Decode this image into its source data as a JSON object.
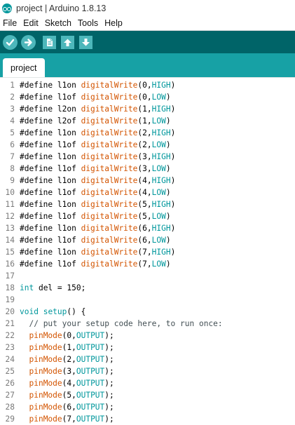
{
  "window": {
    "title": "project | Arduino 1.8.13",
    "icon": "arduino-logo-icon"
  },
  "menu": [
    "File",
    "Edit",
    "Sketch",
    "Tools",
    "Help"
  ],
  "toolbar": {
    "buttons": [
      {
        "name": "verify-button",
        "icon": "check-icon"
      },
      {
        "name": "upload-button",
        "icon": "arrow-right-icon"
      },
      {
        "name": "new-button",
        "icon": "document-icon"
      },
      {
        "name": "open-button",
        "icon": "arrow-up-icon"
      },
      {
        "name": "save-button",
        "icon": "arrow-down-icon"
      }
    ]
  },
  "tabs": [
    {
      "label": "project",
      "active": true
    }
  ],
  "colors": {
    "toolbar_bg": "#006468",
    "tabstrip_bg": "#17a1a5",
    "button_bg": "#4db7bb",
    "keyword_teal": "#00979c",
    "function_orange": "#d35400"
  },
  "code": [
    {
      "n": "1",
      "text": "#define l1on digitalWrite(0,HIGH)"
    },
    {
      "n": "2",
      "text": "#define l1of digitalWrite(0,LOW)"
    },
    {
      "n": "3",
      "text": "#define l2on digitalWrite(1,HIGH)"
    },
    {
      "n": "4",
      "text": "#define l2of digitalWrite(1,LOW)"
    },
    {
      "n": "5",
      "text": "#define l1on digitalWrite(2,HIGH)"
    },
    {
      "n": "6",
      "text": "#define l1of digitalWrite(2,LOW)"
    },
    {
      "n": "7",
      "text": "#define l1on digitalWrite(3,HIGH)"
    },
    {
      "n": "8",
      "text": "#define l1of digitalWrite(3,LOW)"
    },
    {
      "n": "9",
      "text": "#define l1on digitalWrite(4,HIGH)"
    },
    {
      "n": "10",
      "text": "#define l1of digitalWrite(4,LOW)"
    },
    {
      "n": "11",
      "text": "#define l1on digitalWrite(5,HIGH)"
    },
    {
      "n": "12",
      "text": "#define l1of digitalWrite(5,LOW)"
    },
    {
      "n": "13",
      "text": "#define l1on digitalWrite(6,HIGH)"
    },
    {
      "n": "14",
      "text": "#define l1of digitalWrite(6,LOW)"
    },
    {
      "n": "15",
      "text": "#define l1on digitalWrite(7,HIGH)"
    },
    {
      "n": "16",
      "text": "#define l1of digitalWrite(7,LOW)"
    },
    {
      "n": "17",
      "text": ""
    },
    {
      "n": "18",
      "text": "int del = 150;"
    },
    {
      "n": "19",
      "text": ""
    },
    {
      "n": "20",
      "text": "void setup() {"
    },
    {
      "n": "21",
      "text": "  // put your setup code here, to run once:"
    },
    {
      "n": "22",
      "text": "  pinMode(0,OUTPUT);"
    },
    {
      "n": "23",
      "text": "  pinMode(1,OUTPUT);"
    },
    {
      "n": "24",
      "text": "  pinMode(2,OUTPUT);"
    },
    {
      "n": "25",
      "text": "  pinMode(3,OUTPUT);"
    },
    {
      "n": "26",
      "text": "  pinMode(4,OUTPUT);"
    },
    {
      "n": "27",
      "text": "  pinMode(5,OUTPUT);"
    },
    {
      "n": "28",
      "text": "  pinMode(6,OUTPUT);"
    },
    {
      "n": "29",
      "text": "  pinMode(7,OUTPUT);"
    }
  ]
}
